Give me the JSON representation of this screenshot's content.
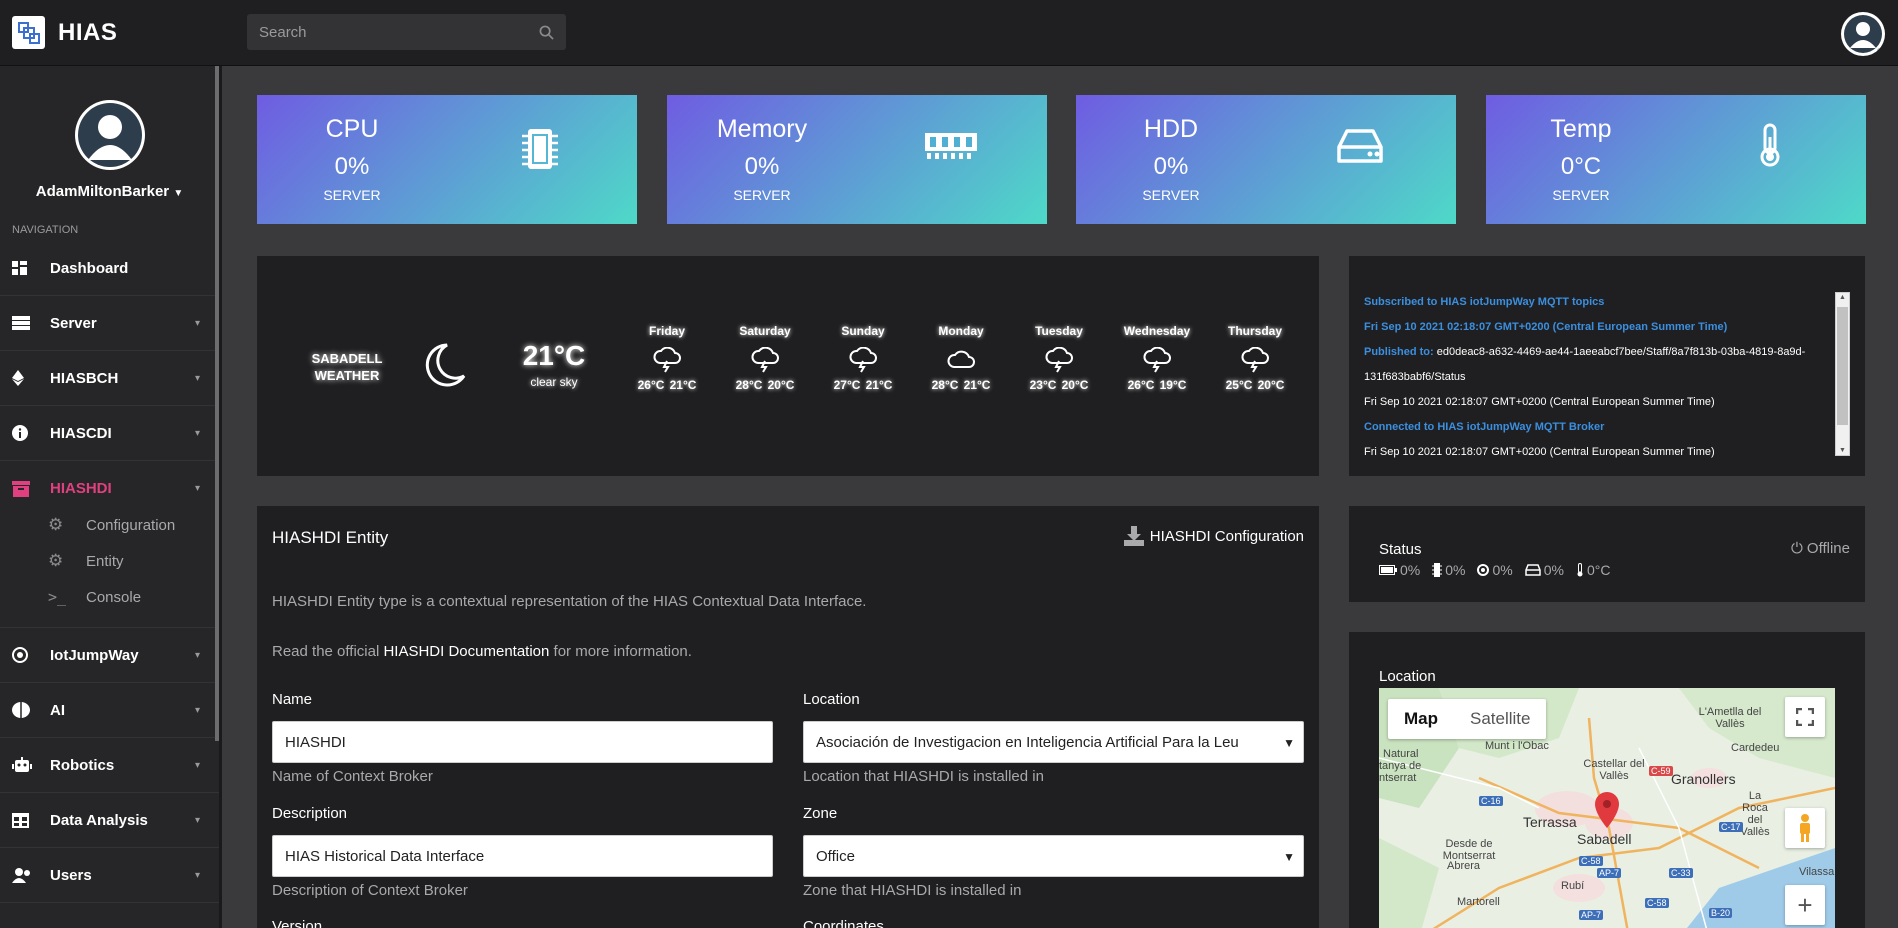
{
  "app": {
    "brand": "HIAS",
    "search_placeholder": "Search"
  },
  "sidebar": {
    "username": "AdamMiltonBarker",
    "nav_label": "NAVIGATION",
    "items": [
      {
        "label": "Dashboard",
        "icon": "dashboard-icon"
      },
      {
        "label": "Server",
        "icon": "server-icon"
      },
      {
        "label": "HIASBCH",
        "icon": "ethereum-icon"
      },
      {
        "label": "HIASCDI",
        "icon": "info-icon"
      },
      {
        "label": "HIASHDI",
        "icon": "archive-icon"
      },
      {
        "label": "IotJumpWay",
        "icon": "iot-icon"
      },
      {
        "label": "AI",
        "icon": "brain-icon"
      },
      {
        "label": "Robotics",
        "icon": "robot-icon"
      },
      {
        "label": "Data Analysis",
        "icon": "table-icon"
      },
      {
        "label": "Users",
        "icon": "users-icon"
      }
    ],
    "subitems": [
      {
        "label": "Configuration",
        "icon": "cogs-icon"
      },
      {
        "label": "Entity",
        "icon": "cogs-icon"
      },
      {
        "label": "Console",
        "icon": "terminal-icon"
      }
    ]
  },
  "stats": [
    {
      "title": "CPU",
      "value": "0%",
      "sub": "SERVER",
      "icon": "cpu-icon"
    },
    {
      "title": "Memory",
      "value": "0%",
      "sub": "SERVER",
      "icon": "memory-icon"
    },
    {
      "title": "HDD",
      "value": "0%",
      "sub": "SERVER",
      "icon": "hdd-icon"
    },
    {
      "title": "Temp",
      "value": "0°C",
      "sub": "SERVER",
      "icon": "thermometer-icon"
    }
  ],
  "weather": {
    "city": "SABADELL",
    "label": "WEATHER",
    "temp": "21°C",
    "desc": "clear sky",
    "days": [
      {
        "name": "Friday",
        "high": "26°C",
        "low": "21°C",
        "icon": "thunderstorm-icon"
      },
      {
        "name": "Saturday",
        "high": "28°C",
        "low": "20°C",
        "icon": "thunderstorm-icon"
      },
      {
        "name": "Sunday",
        "high": "27°C",
        "low": "21°C",
        "icon": "thunderstorm-icon"
      },
      {
        "name": "Monday",
        "high": "28°C",
        "low": "21°C",
        "icon": "cloud-icon"
      },
      {
        "name": "Tuesday",
        "high": "23°C",
        "low": "20°C",
        "icon": "thunderstorm-icon"
      },
      {
        "name": "Wednesday",
        "high": "26°C",
        "low": "19°C",
        "icon": "thunderstorm-icon"
      },
      {
        "name": "Thursday",
        "high": "25°C",
        "low": "20°C",
        "icon": "thunderstorm-icon"
      }
    ]
  },
  "log": {
    "line1": "Subscribed to HIAS iotJumpWay MQTT topics",
    "line2": "Fri Sep 10 2021 02:18:07 GMT+0200 (Central European Summer Time)",
    "line3_label": "Published to:",
    "line3_text": " ed0deac8-a632-4469-ae44-1aeeabcf7bee/Staff/8a7f813b-03ba-4819-8a9d-",
    "line4": "131f683babf6/Status",
    "line5": "Fri Sep 10 2021 02:18:07 GMT+0200 (Central European Summer Time)",
    "line6": "Connected to HIAS iotJumpWay MQTT Broker",
    "line7": "Fri Sep 10 2021 02:18:07 GMT+0200 (Central European Summer Time)"
  },
  "entity": {
    "title": "HIASHDI Entity",
    "config_button": "HIASHDI Configuration",
    "description": "HIASHDI Entity type is a contextual representation of the HIAS Contextual Data Interface.",
    "read_prefix": "Read the official ",
    "read_link": "HIASHDI Documentation",
    "read_suffix": " for more information.",
    "name_label": "Name",
    "name_value": "HIASHDI",
    "name_help": "Name of Context Broker",
    "location_label": "Location",
    "location_value": "Asociación de Investigacion en Inteligencia Artificial Para la Leu",
    "location_help": "Location that HIASHDI is installed in",
    "desc_label": "Description",
    "desc_value": "HIAS Historical Data Interface",
    "desc_help": "Description of Context Broker",
    "zone_label": "Zone",
    "zone_value": "Office",
    "zone_help": "Zone that HIASHDI is installed in",
    "version_label": "Version",
    "coords_label": "Coordinates"
  },
  "status": {
    "title": "Status",
    "state": "Offline",
    "battery": "0%",
    "cpu": "0%",
    "mem": "0%",
    "hdd": "0%",
    "temp": "0°C"
  },
  "location": {
    "title": "Location",
    "map_tab": "Map",
    "satellite_tab": "Satellite",
    "places": [
      "Terrassa",
      "Sabadell",
      "Granollers",
      "L'Ametlla del Vallès",
      "Cardedeu",
      "Castellar del Vallès",
      "Munt i l'Obac",
      "Desde de Montserrat",
      "Abrera",
      "Martorell",
      "Rubí",
      "La Roca del Vallès",
      "Vilassar",
      "Natural",
      "tanya de",
      "ntserrat"
    ],
    "roads": [
      "C-59",
      "C-16",
      "C-58",
      "C-17",
      "AP-7",
      "C-33",
      "C-58",
      "B-20",
      "AP-7"
    ],
    "zoom_in": "+"
  },
  "colors": {
    "accent": "#e0407f",
    "log_blue": "#3b8fdf"
  }
}
